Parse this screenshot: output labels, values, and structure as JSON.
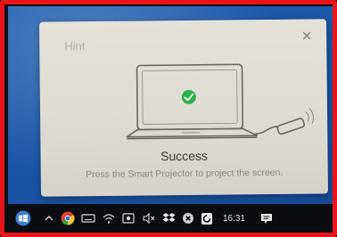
{
  "dialog": {
    "title": "Hint",
    "status": "Success",
    "message": "Press the Smart Projector to project the screen."
  },
  "icons": {
    "close": "close-icon",
    "laptop": "laptop-illustration",
    "check": "check-circle-icon",
    "dongle": "wireless-dongle-icon"
  },
  "taskbar": {
    "time": "16:31",
    "tray_icons": [
      "chevron-up-icon",
      "chrome-icon",
      "keyboard-icon",
      "wifi-icon",
      "photos-icon",
      "volume-muted-icon",
      "dropbox-icon",
      "close-circle-icon",
      "security-icon"
    ]
  },
  "colors": {
    "frame": "#e8141a",
    "desktop": "#1a56a6",
    "dialog": "#e0ddd4",
    "check": "#2bb04a"
  }
}
